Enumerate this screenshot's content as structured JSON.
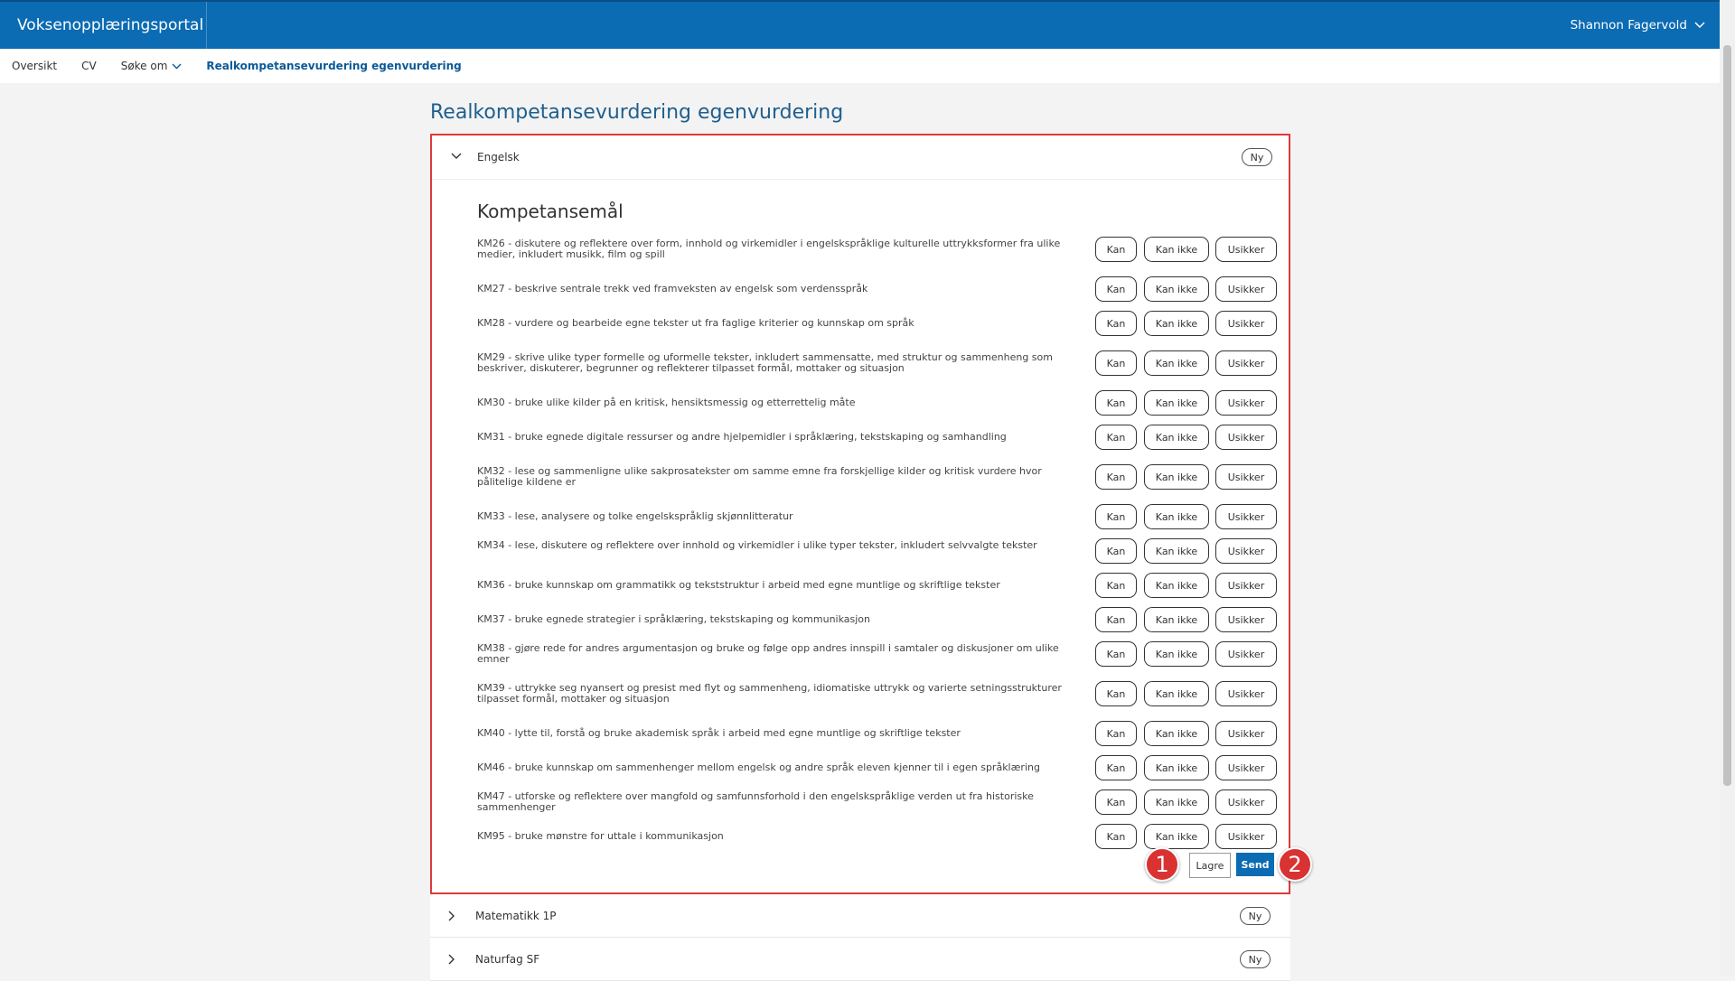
{
  "header": {
    "app_title": "Voksenopplæringsportal",
    "user_name": "Shannon Fagervold"
  },
  "nav": {
    "items": [
      {
        "label": "Oversikt"
      },
      {
        "label": "CV"
      },
      {
        "label": "Søke om"
      },
      {
        "label": "Realkompetansevurdering egenvurdering"
      }
    ]
  },
  "page": {
    "title": "Realkompetansevurdering egenvurdering"
  },
  "panel": {
    "subject": "Engelsk",
    "badge": "Ny",
    "section_title": "Kompetansemål",
    "buttons": {
      "kan": "Kan",
      "kan_ikke": "Kan ikke",
      "usikker": "Usikker"
    },
    "goals": [
      {
        "text": "KM26 - diskutere og reflektere over form, innhold og virkemidler i engelskspråklige kulturelle uttrykksformer fra ulike medier, inkludert musikk, film og spill"
      },
      {
        "text": "KM27 - beskrive sentrale trekk ved framveksten av engelsk som verdensspråk"
      },
      {
        "text": "KM28 - vurdere og bearbeide egne tekster ut fra faglige kriterier og kunnskap om språk"
      },
      {
        "text": "KM29 - skrive ulike typer formelle og uformelle tekster, inkludert sammensatte, med struktur og sammenheng som beskriver, diskuterer, begrunner og reflekterer tilpasset formål, mottaker og situasjon"
      },
      {
        "text": "KM30 - bruke ulike kilder på en kritisk, hensiktsmessig og etterrettelig måte"
      },
      {
        "text": "KM31 - bruke egnede digitale ressurser og andre hjelpemidler i språklæring, tekstskaping og samhandling"
      },
      {
        "text": "KM32 - lese og sammenligne ulike sakprosatekster om samme emne fra forskjellige kilder og kritisk vurdere hvor pålitelige kildene er"
      },
      {
        "text": "KM33 - lese, analysere og tolke engelskspråklig skjønnlitteratur"
      },
      {
        "text": "KM34 - lese, diskutere og reflektere over innhold og virkemidler i ulike typer tekster, inkludert selvvalgte tekster"
      },
      {
        "text": "KM36 - bruke kunnskap om grammatikk og tekststruktur i arbeid med egne muntlige og skriftlige tekster"
      },
      {
        "text": "KM37 - bruke egnede strategier i språklæring, tekstskaping og kommunikasjon"
      },
      {
        "text": "KM38 - gjøre rede for andres argumentasjon og bruke og følge opp andres innspill i samtaler og diskusjoner om ulike emner"
      },
      {
        "text": "KM39 - uttrykke seg nyansert og presist med flyt og sammenheng, idiomatiske uttrykk og varierte setningsstrukturer tilpasset formål, mottaker og situasjon"
      },
      {
        "text": "KM40 - lytte til, forstå og bruke akademisk språk i arbeid med egne muntlige og skriftlige tekster"
      },
      {
        "text": "KM46 - bruke kunnskap om sammenhenger mellom engelsk og andre språk eleven kjenner til i egen språklæring"
      },
      {
        "text": "KM47 - utforske og reflektere over mangfold og samfunnsforhold i den engelskspråklige verden ut fra historiske sammenhenger"
      },
      {
        "text": "KM95 - bruke mønstre for uttale i kommunikasjon"
      }
    ],
    "save_label": "Lagre",
    "send_label": "Send"
  },
  "markers": [
    "1",
    "2"
  ],
  "other_subjects": [
    {
      "name": "Matematikk 1P",
      "badge": "Ny"
    },
    {
      "name": "Naturfag SF",
      "badge": "Ny"
    }
  ],
  "colors": {
    "header_blue": "#0b6bb3",
    "highlight_red": "#dd3b3b",
    "marker_red": "#d93232"
  }
}
